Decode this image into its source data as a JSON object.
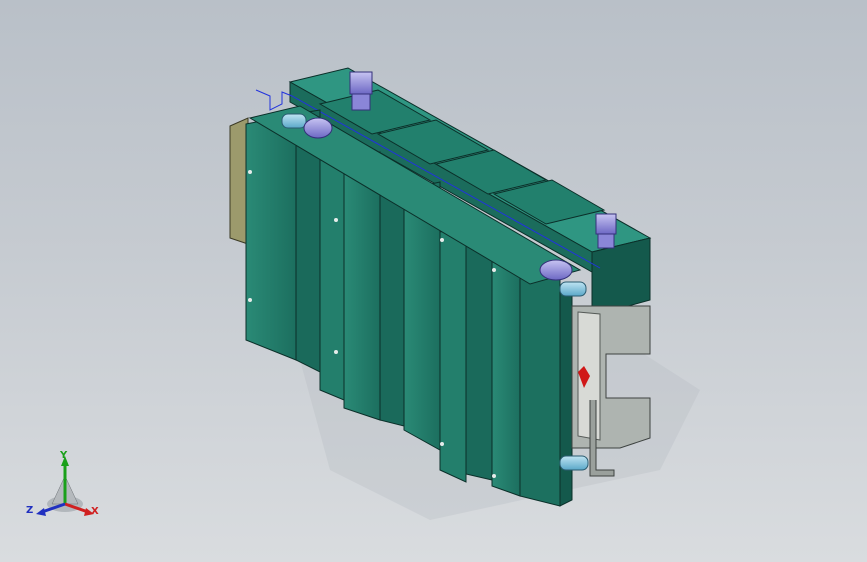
{
  "viewport": {
    "background_top": "#b9c0c8",
    "background_bottom": "#d9dcdf"
  },
  "model": {
    "colors": {
      "frame_green": "#1f7a68",
      "frame_dark": "#0f4a40",
      "frame_light": "#2f9682",
      "cylinder_purple": "#8a86d8",
      "panel_khaki": "#9c9a6c",
      "panel_grey": "#aeb4b0",
      "accent_red": "#d01818"
    }
  },
  "triad": {
    "x_label": "X",
    "y_label": "Y",
    "z_label": "Z",
    "x_color": "#d02020",
    "y_color": "#1aa01a",
    "z_color": "#2030c0"
  }
}
